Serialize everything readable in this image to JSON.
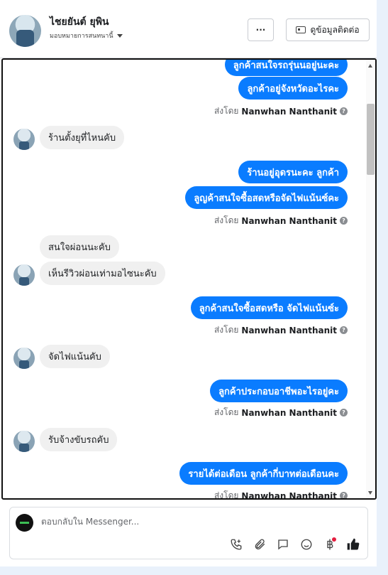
{
  "header": {
    "contact_name": "ไชยยันต์ ยุพิน",
    "assign_label": "มอบหมายการสนทนานี้",
    "more_label": "···",
    "details_label": "ดูข้อมูลติดต่อ"
  },
  "messages": {
    "out_1": "ลูกค้าสนใจรถรุ่นนอยู่นะคะ",
    "out_2": "ลูกค้าอยู่จังหวัดอะไรคะ",
    "sent_label": "ส่งโดย",
    "sender_name": "Nanwhan Nanthanit",
    "help_icon": "?",
    "in_1": "ร้านตั้งยุที่ไหนคับ",
    "out_3": "ร้านอยู่อุดรนะคะ ลูกค้า",
    "out_4": "ลูญค้าสนใจซื้อสดหรือจัดไฟแน้นซ์คะ",
    "in_2": "สนใจผ่อนนะคับ",
    "in_3": "เห็นรีวิวผ่อนเท่ามอไซนะคับ",
    "out_5": "ลูกค้าสนใจซื้อสดหรือ จัดไฟแน้นซ์ะ",
    "in_4": "จัดไฟแน้นคับ",
    "out_6": "ลูกค้าประกอบอาชีพอะไรอยู่คะ",
    "in_5": "รับจ้างขับรถคับ",
    "out_7": "รายได้ต่อเดือน ลูกค้ากี่บาทต่อเดือนคะ"
  },
  "composer": {
    "placeholder": "ตอบกลับใน Messenger..."
  },
  "icons": [
    "more-icon",
    "contact-card-icon",
    "chevron-down-icon",
    "help-icon",
    "call-icon",
    "attach-icon",
    "saved-reply-icon",
    "emoji-icon",
    "payment-icon",
    "like-icon"
  ],
  "colors": {
    "outgoing_bubble": "#0a7cff",
    "incoming_bubble": "#f0f0f0",
    "like_icon": "#1c1e21"
  }
}
